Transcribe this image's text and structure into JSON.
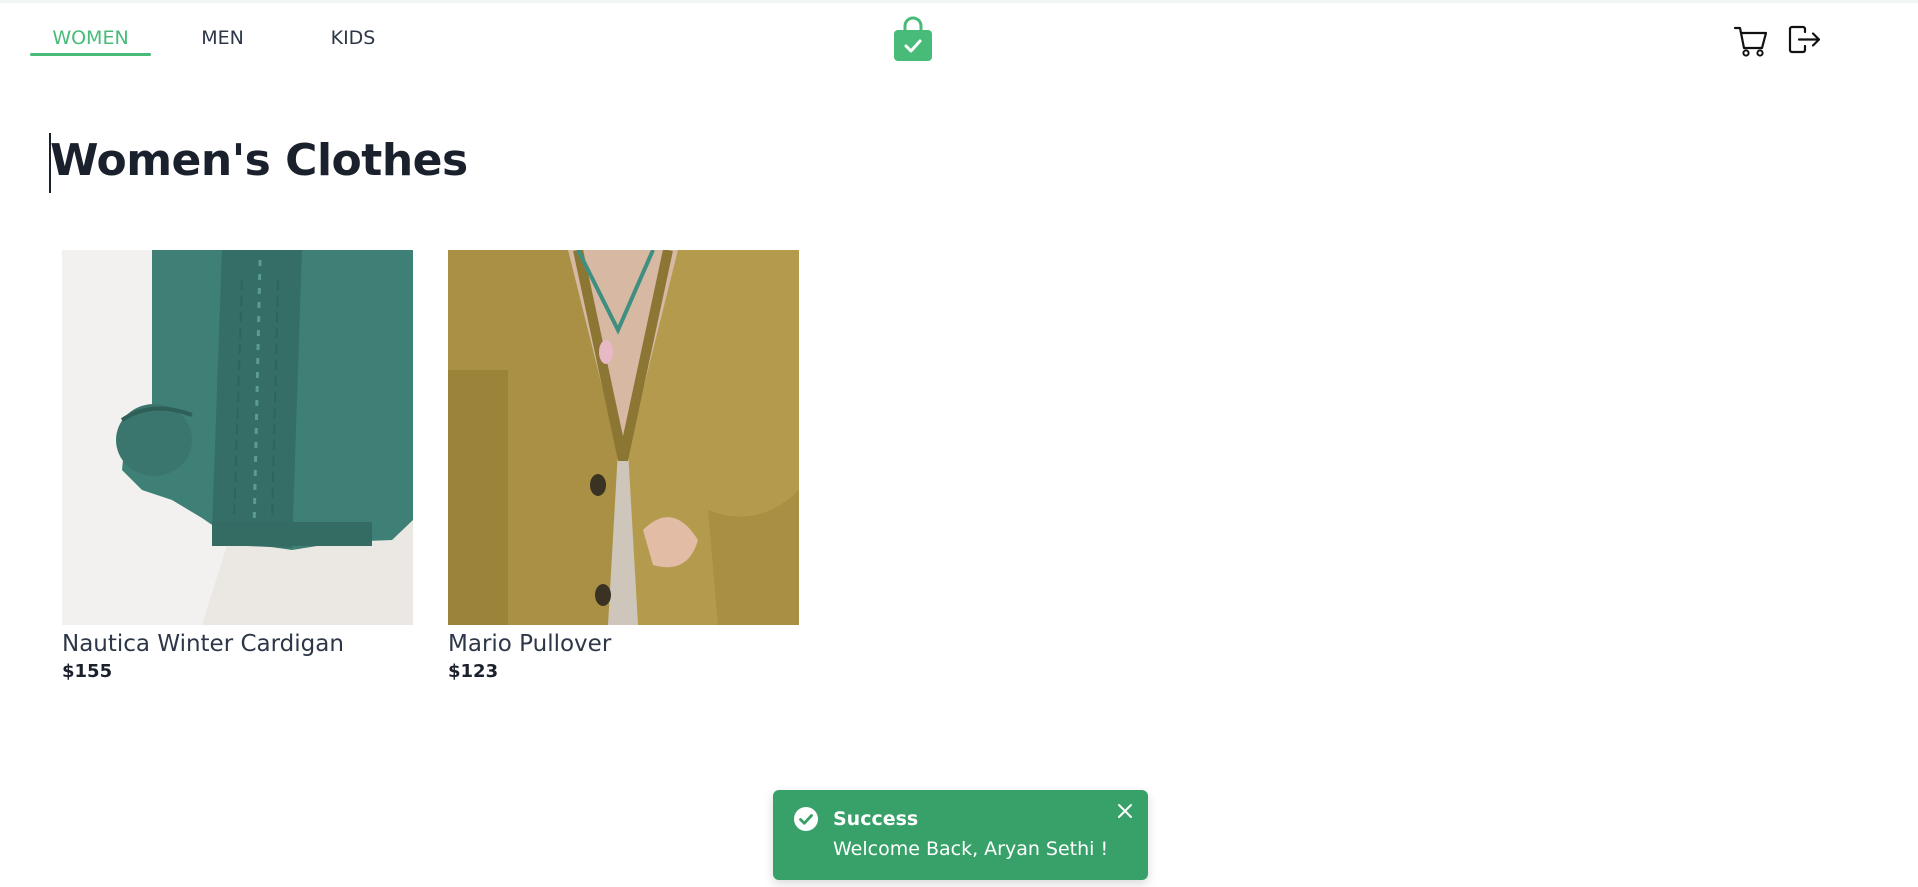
{
  "nav": {
    "tabs": [
      {
        "label": "WOMEN",
        "active": true
      },
      {
        "label": "MEN",
        "active": false
      },
      {
        "label": "KIDS",
        "active": false
      }
    ],
    "logo_icon": "shopping-bag-check-icon",
    "cart_icon": "cart-icon",
    "logout_icon": "logout-icon"
  },
  "main": {
    "title": "Women's Clothes",
    "products": [
      {
        "name": "Nautica Winter Cardigan",
        "price": "$155"
      },
      {
        "name": "Mario Pullover",
        "price": "$123"
      }
    ]
  },
  "toast": {
    "title": "Success",
    "message": "Welcome Back, Aryan Sethi !",
    "icon": "check-circle-icon",
    "close_icon": "close-icon"
  },
  "colors": {
    "accent": "#48bb78",
    "toast_bg": "#38a169",
    "text": "#1a202c"
  }
}
